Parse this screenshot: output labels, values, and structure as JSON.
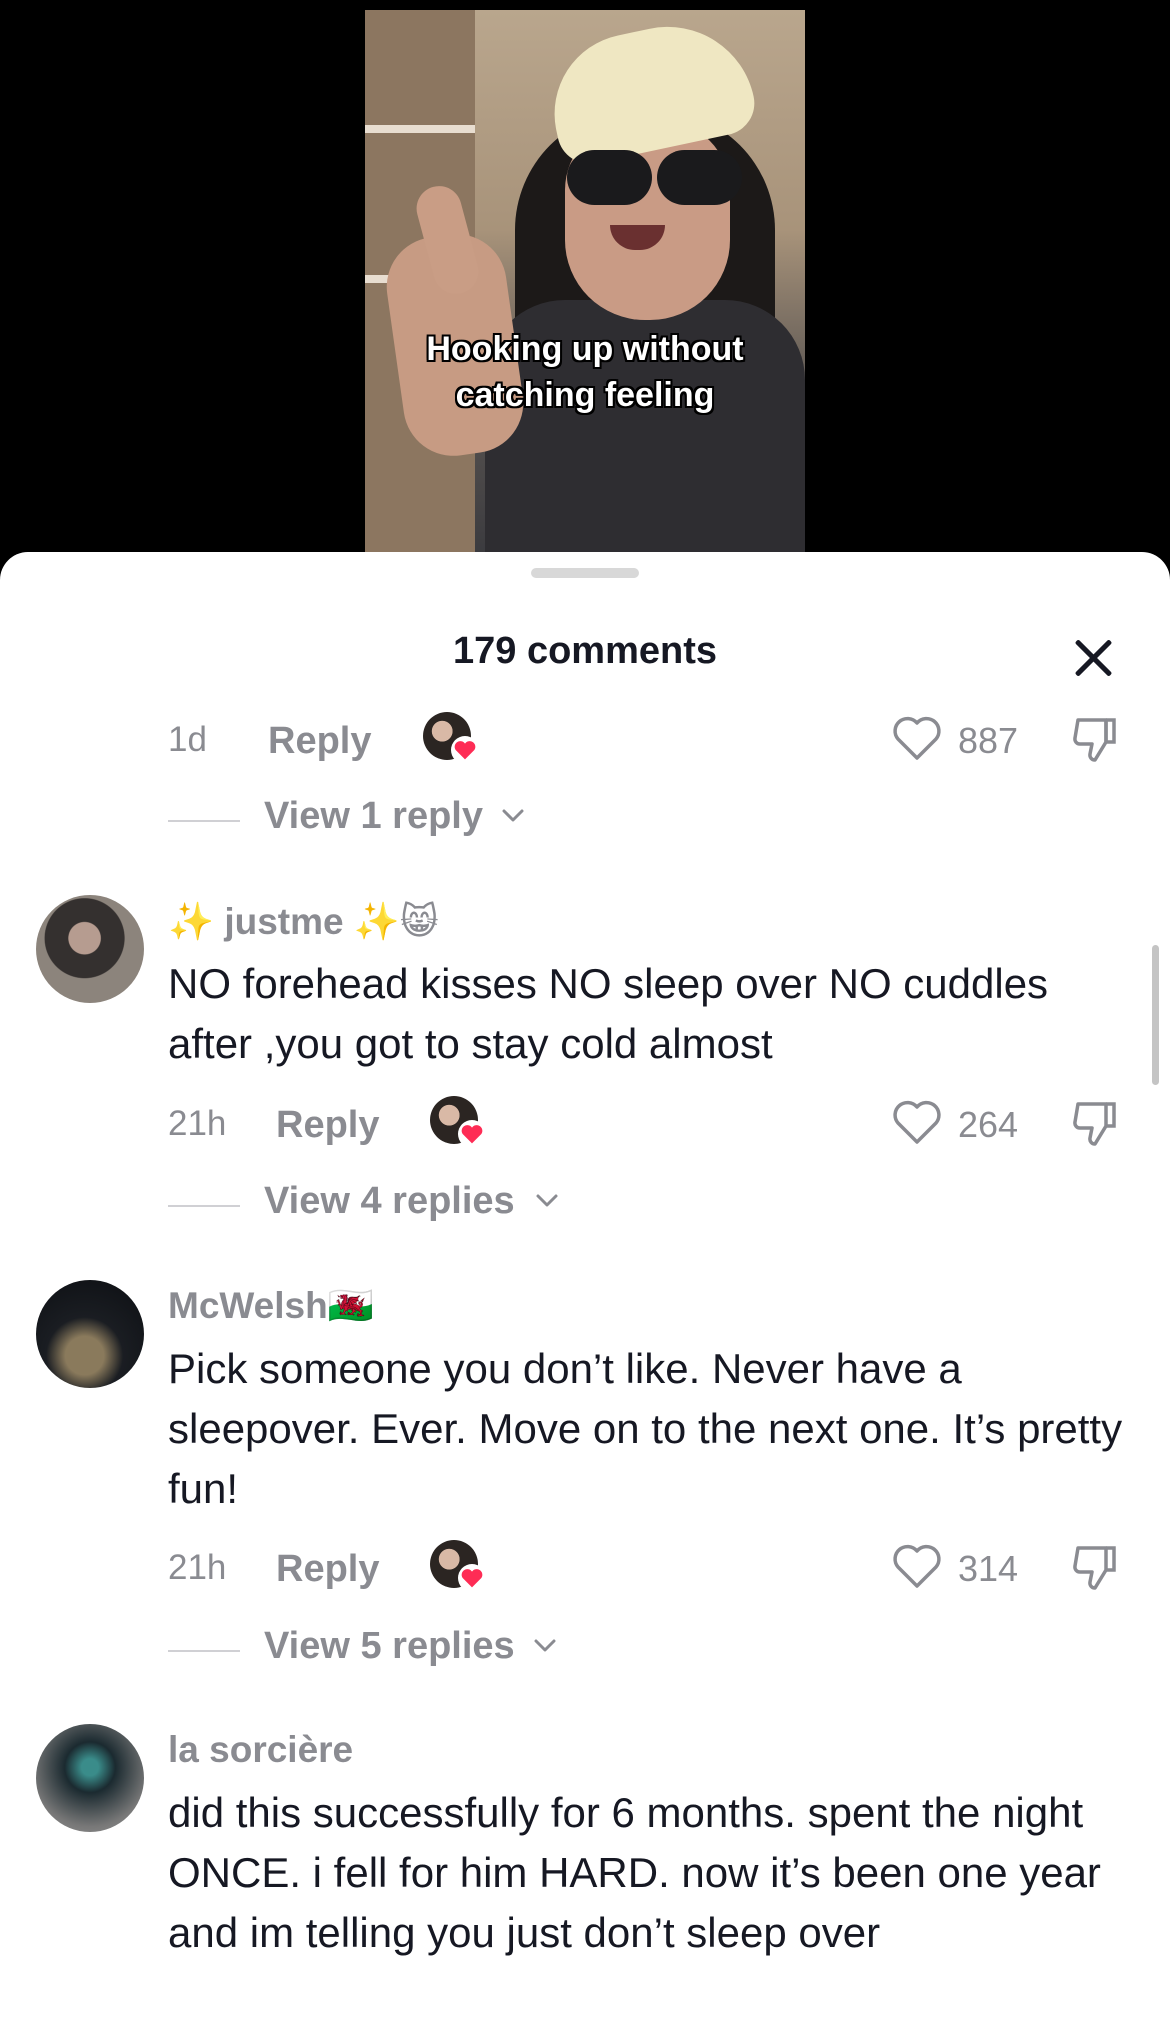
{
  "video": {
    "caption_line1": "Hooking up without",
    "caption_line2": "catching feeling"
  },
  "sheet": {
    "comment_count": "179 comments"
  },
  "first_meta": {
    "time": "1d",
    "reply": "Reply",
    "likes": "887",
    "view_replies": "View 1 reply"
  },
  "comments": [
    {
      "username": "✨ justme ✨😸",
      "text": "NO forehead kisses NO sleep over NO cuddles after ,you got to stay cold almost",
      "time": "21h",
      "reply": "Reply",
      "likes": "264",
      "view_replies": "View 4 replies"
    },
    {
      "username": "McWelsh🏴󠁧󠁢󠁷󠁬󠁳󠁿",
      "text": "Pick someone you don’t like. Never have a sleepover. Ever. Move on to the next one. It’s pretty fun!",
      "time": "21h",
      "reply": "Reply",
      "likes": "314",
      "view_replies": "View 5 replies"
    },
    {
      "username": "la sorcière",
      "text": "did this successfully for 6 months. spent the night ONCE. i fell for him HARD. now it’s been one year and im telling you just don’t sleep over"
    }
  ],
  "colors": {
    "text": "#161823",
    "secondary": "#8a8b91",
    "heart": "#fe2c55"
  },
  "icons": [
    "close-icon",
    "heart-icon",
    "dislike-icon",
    "chevron-down-icon",
    "creator-liked-heart-icon"
  ]
}
